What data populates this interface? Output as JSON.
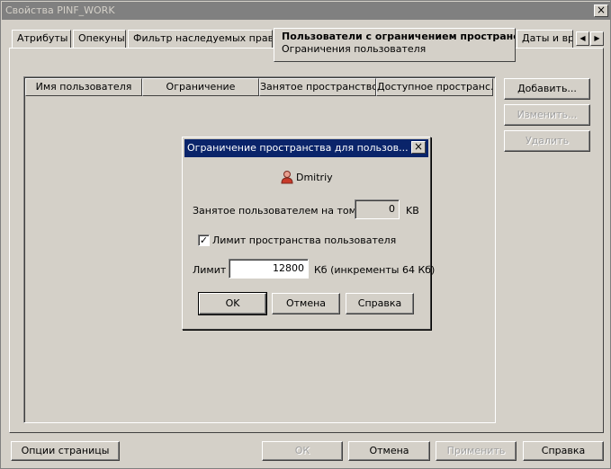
{
  "window": {
    "title": "Свойства  PINF_WORK",
    "close": "×"
  },
  "tabs": [
    {
      "label": "Атрибуты"
    },
    {
      "label": "Опекуны"
    },
    {
      "label": "Фильтр наследуемых прав..."
    },
    {
      "label": "Пользователи с ограничением пространства",
      "sublabel": "Ограничения пользователя"
    },
    {
      "label": "Даты и вр"
    }
  ],
  "tab_scroll": {
    "left": "◀",
    "right": "▶"
  },
  "table": {
    "columns": [
      "Имя пользователя",
      "Ограничение",
      "Занятое пространство",
      "Доступное пространс..."
    ]
  },
  "side_buttons": {
    "add": "Добавить...",
    "edit": "Изменить...",
    "delete": "Удалить"
  },
  "bottom": {
    "page_options": "Опции страницы",
    "ok": "ОК",
    "cancel": "Отмена",
    "apply": "Применить",
    "help": "Справка"
  },
  "dialog": {
    "title": "Ограничение пространства для пользов...",
    "close": "×",
    "user": "Dmitriy",
    "used_label": "Занятое пользователем на томе:",
    "used_value": "0",
    "used_unit": "KB",
    "limit_checkbox_label": "Лимит пространства пользователя",
    "limit_checked": true,
    "check_mark": "✓",
    "limit_label": "Лимит",
    "limit_value": "12800",
    "limit_unit": "Кб (инкременты 64 Кб)",
    "ok": "OK",
    "cancel": "Отмена",
    "help": "Справка"
  },
  "colors": {
    "face": "#d4d0c8",
    "active_title": "#0a246a",
    "inactive_title": "#808080"
  }
}
